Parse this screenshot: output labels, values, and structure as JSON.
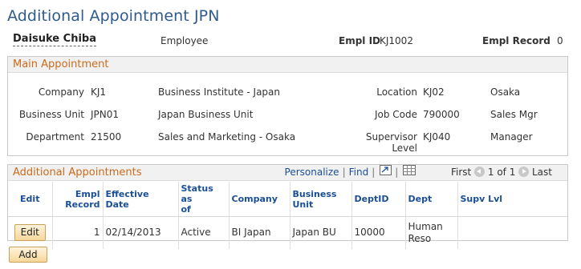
{
  "page": {
    "title": "Additional Appointment JPN"
  },
  "header": {
    "name": "Daisuke Chiba",
    "role": "Employee",
    "empl_id_label": "Empl ID",
    "empl_id": "KJ1002",
    "empl_record_label": "Empl Record",
    "empl_record": "0"
  },
  "main_appointment": {
    "title": "Main Appointment",
    "company_label": "Company",
    "company_code": "KJ1",
    "company_desc": "Business Institute - Japan",
    "bu_label": "Business Unit",
    "bu_code": "JPN01",
    "bu_desc": "Japan Business Unit",
    "dept_label": "Department",
    "dept_code": "21500",
    "dept_desc": "Sales and Marketing - Osaka",
    "location_label": "Location",
    "location_code": "KJ02",
    "location_desc": "Osaka",
    "jobcode_label": "Job Code",
    "jobcode_code": "790000",
    "jobcode_desc": "Sales Mgr",
    "supv_label_1": "Supervisor",
    "supv_label_2": "Level",
    "supv_code": "KJ040",
    "supv_desc": "Manager"
  },
  "additional": {
    "title": "Additional Appointments",
    "personalize": "Personalize",
    "find": "Find",
    "first": "First",
    "range": "1 of 1",
    "last": "Last",
    "columns": {
      "edit": "Edit",
      "empl_record_1": "Empl",
      "empl_record_2": "Record",
      "effdt": "Effective Date",
      "status_1": "Status as",
      "status_2": "of",
      "company": "Company",
      "bu_1": "Business",
      "bu_2": "Unit",
      "deptid": "DeptID",
      "dept": "Dept",
      "supv": "Supv Lvl"
    },
    "rows": [
      {
        "edit_label": "Edit",
        "empl_record": "1",
        "effdt": "02/14/2013",
        "status": "Active",
        "company": "BI Japan",
        "bu": "Japan BU",
        "deptid": "10000",
        "dept_1": "Human",
        "dept_2": "Reso",
        "supv": ""
      }
    ]
  },
  "add_button": "Add",
  "icons": {
    "zoom": "zoom-grid-icon",
    "download": "download-grid-icon",
    "prev": "previous-arrow-icon",
    "next": "next-arrow-icon"
  },
  "colors": {
    "title": "#2f5b8c",
    "section_header": "#cc6b1a",
    "link": "#1a4f95",
    "button": "#f6d79a"
  }
}
